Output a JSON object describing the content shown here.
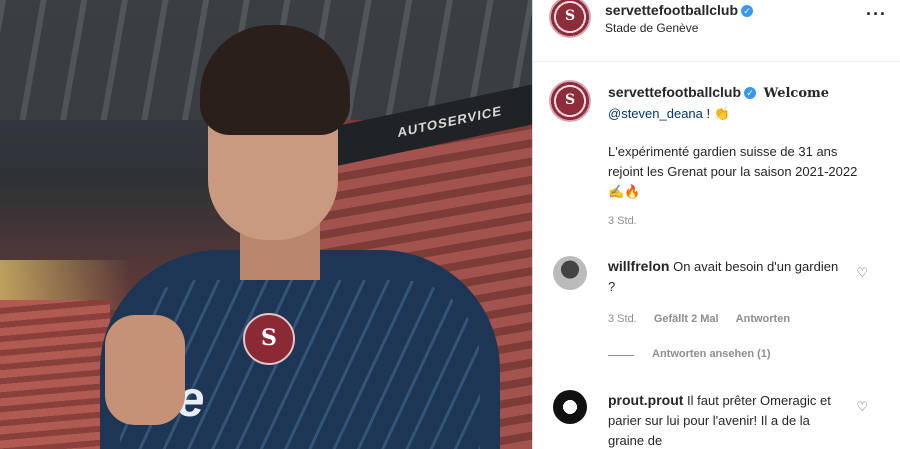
{
  "post": {
    "username": "servettefootballclub",
    "location": "Stade de Genève",
    "avatar_letter": "S",
    "banner_text": "AUTOSERVICE",
    "shirt_text": "fe"
  },
  "caption": {
    "username": "servettefootballclub",
    "welcome": "Welcome",
    "mention": "@steven_deana",
    "after_mention": " ! 👏",
    "body": "L'expérimenté gardien suisse de 31 ans rejoint les Grenat pour la saison 2021-2022 ✍️🔥",
    "time": "3 Std."
  },
  "comments": [
    {
      "username": "willfrelon",
      "text": "On avait besoin d'un gardien ?",
      "time": "3 Std.",
      "likes": "Gefällt 2 Mal",
      "reply": "Antworten",
      "view_replies": "Antworten ansehen (1)"
    },
    {
      "username": "prout.prout",
      "text": "Il faut prêter Omeragic et parier sur lui pour l'avenir! Il a de la graine de"
    }
  ],
  "icons": {
    "more": "more-options-icon",
    "verified": "verified-badge-icon",
    "heart": "heart-icon"
  },
  "colors": {
    "brand": "#8d2c3b",
    "verified": "#3897f0",
    "secondary_text": "#8e8e8e"
  }
}
